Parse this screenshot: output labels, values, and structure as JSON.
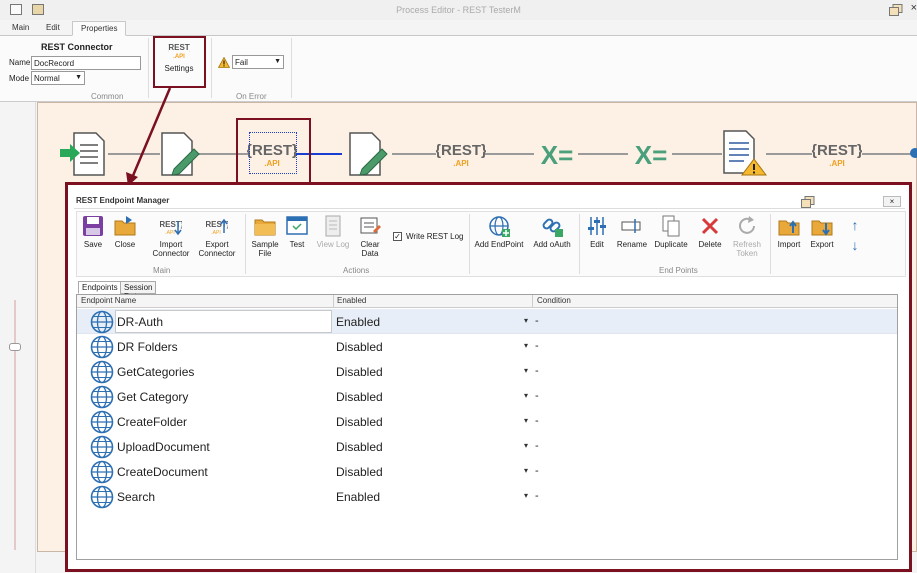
{
  "window": {
    "title": "Process Editor - REST TesterM",
    "close_glyph": "×"
  },
  "tabs": [
    {
      "label": "Main"
    },
    {
      "label": "Edit"
    },
    {
      "label": "Properties"
    }
  ],
  "ribbon": {
    "rest_connector": {
      "heading": "REST Connector",
      "name_label": "Name",
      "name_value": "DocRecord",
      "mode_label": "Mode",
      "mode_value": "Normal",
      "group_caption": "Common"
    },
    "settings": {
      "label": "Settings",
      "icon": "rest-api-icon"
    },
    "on_error": {
      "value": "Fail",
      "group_caption": "On Error",
      "icon": "warning-icon"
    }
  },
  "flow": {
    "rest_label": "{REST}",
    "api_label": ".API",
    "x_label": "X=",
    "nodes": [
      "document-in-icon",
      "document-edit-icon",
      "rest-api-icon",
      "document-edit-icon",
      "rest-api-icon",
      "xform-icon",
      "xform-icon",
      "document-warning-icon",
      "rest-api-icon"
    ]
  },
  "dialog": {
    "title": "REST Endpoint Manager",
    "close_glyph": "×",
    "groups": {
      "main": "Main",
      "actions": "Actions",
      "endpoints": "End Points"
    },
    "buttons": {
      "save": "Save",
      "close": "Close",
      "import_connector_1": "Import",
      "import_connector_2": "Connector",
      "export_connector_1": "Export",
      "export_connector_2": "Connector",
      "sample_file_1": "Sample",
      "sample_file_2": "File",
      "test": "Test",
      "view_log": "View Log",
      "clear_data_1": "Clear",
      "clear_data_2": "Data",
      "write_rest_log": "Write REST Log",
      "write_rest_log_checked": "✓",
      "add_endpoint": "Add EndPoint",
      "add_oauth": "Add oAuth",
      "edit": "Edit",
      "rename": "Rename",
      "duplicate": "Duplicate",
      "delete": "Delete",
      "refresh_token_1": "Refresh",
      "refresh_token_2": "Token",
      "import": "Import",
      "export": "Export",
      "up_arrow": "↑",
      "down_arrow": "↓"
    },
    "subtabs": [
      {
        "label": "Endpoints"
      },
      {
        "label": "Session Data"
      }
    ],
    "columns": {
      "name": "Endpoint Name",
      "enabled": "Enabled",
      "condition": "Condition"
    },
    "rows": [
      {
        "name": "DR-Auth",
        "enabled": "Enabled",
        "dropdown": "▾",
        "condition": "-"
      },
      {
        "name": "DR Folders",
        "enabled": "Disabled",
        "dropdown": "▾",
        "condition": "-"
      },
      {
        "name": "GetCategories",
        "enabled": "Disabled",
        "dropdown": "▾",
        "condition": "-"
      },
      {
        "name": "Get Category",
        "enabled": "Disabled",
        "dropdown": "▾",
        "condition": "-"
      },
      {
        "name": "CreateFolder",
        "enabled": "Disabled",
        "dropdown": "▾",
        "condition": "-"
      },
      {
        "name": "UploadDocument",
        "enabled": "Disabled",
        "dropdown": "▾",
        "condition": "-"
      },
      {
        "name": "CreateDocument",
        "enabled": "Disabled",
        "dropdown": "▾",
        "condition": "-"
      },
      {
        "name": "Search",
        "enabled": "Enabled",
        "dropdown": "▾",
        "condition": "-"
      }
    ]
  },
  "colors": {
    "highlight": "#7a1020",
    "rest_green": "#3aa864",
    "rest_orange": "#f0a020",
    "globe_blue": "#2d6fb3",
    "canvas_bg": "#fdf1e6"
  }
}
